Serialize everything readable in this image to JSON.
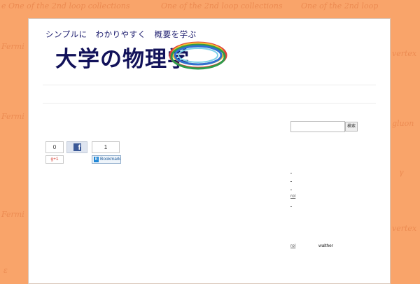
{
  "header": {
    "tagline": "シンプルに　わかりやすく　概要を学ぶ",
    "site_title": "大学の物理学"
  },
  "share": {
    "gplus_count": "0",
    "gplus_label": "g+1",
    "facebook_icon": "f",
    "hatena_count": "1",
    "hatena_label": "Bookmark",
    "hatena_icon": "B"
  },
  "sidebar": {
    "search": {
      "value": "",
      "button_label": "検索"
    },
    "links": [
      "",
      "",
      "",
      "rol",
      ""
    ],
    "bottom_link": "rol",
    "bottom_name": "walther"
  },
  "colors": {
    "background": "#f9a46a",
    "title": "#12125a",
    "facebook": "#3b5998"
  },
  "icons": {
    "banner": "physics-rings-logo",
    "facebook": "facebook-icon",
    "google_plus": "google-plus-icon",
    "hatena": "hatena-bookmark-icon"
  }
}
